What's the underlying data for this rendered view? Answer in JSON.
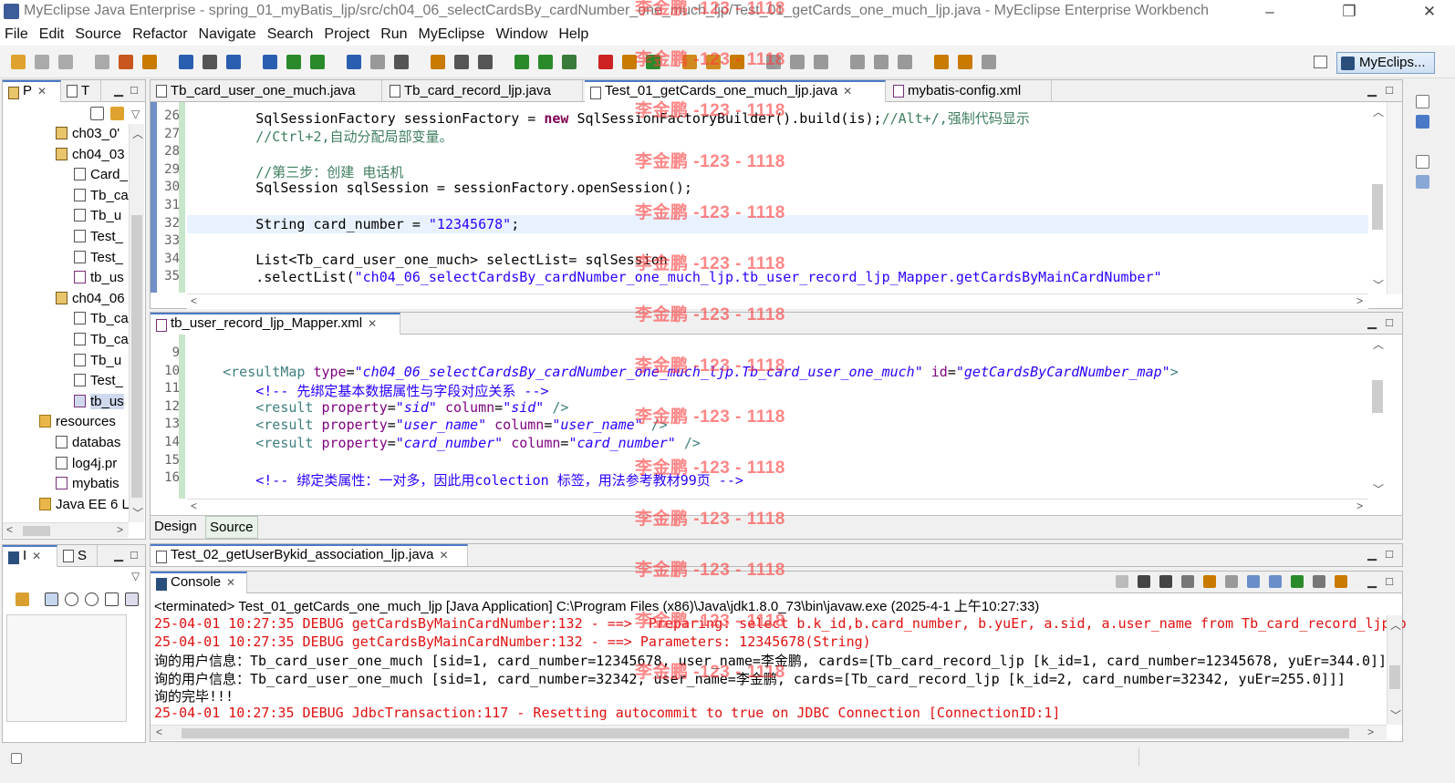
{
  "window": {
    "title": "MyEclipse Java Enterprise - spring_01_myBatis_ljp/src/ch04_06_selectCardsBy_cardNumber_one_much_ljp/Test_01_getCards_one_much_ljp.java - MyEclipse Enterprise Workbench",
    "minimize": "–",
    "restore": "❐",
    "close": "✕"
  },
  "menu": [
    "File",
    "Edit",
    "Source",
    "Refactor",
    "Navigate",
    "Search",
    "Project",
    "Run",
    "MyEclipse",
    "Window",
    "Help"
  ],
  "toolbar": {
    "perspective_label": "MyEclips..."
  },
  "explorer": {
    "tabs": [
      "P",
      "T"
    ],
    "items": [
      {
        "label": "ch03_0'",
        "icon": "package"
      },
      {
        "label": "ch04_03",
        "icon": "package"
      },
      {
        "label": "Card_",
        "icon": "java"
      },
      {
        "label": "Tb_ca",
        "icon": "java"
      },
      {
        "label": "Tb_u",
        "icon": "java"
      },
      {
        "label": "Test_",
        "icon": "java"
      },
      {
        "label": "Test_",
        "icon": "java"
      },
      {
        "label": "tb_us",
        "icon": "xml"
      },
      {
        "label": "ch04_06",
        "icon": "package"
      },
      {
        "label": "Tb_ca",
        "icon": "java"
      },
      {
        "label": "Tb_ca",
        "icon": "java"
      },
      {
        "label": "Tb_u",
        "icon": "java"
      },
      {
        "label": "Test_",
        "icon": "java"
      },
      {
        "label": "tb_us",
        "icon": "xml"
      },
      {
        "label": "resources",
        "icon": "folder"
      },
      {
        "label": "databas",
        "icon": "file"
      },
      {
        "label": "log4j.pr",
        "icon": "file"
      },
      {
        "label": "mybatis",
        "icon": "xml"
      },
      {
        "label": "Java EE 6 L",
        "icon": "lib"
      }
    ]
  },
  "outline": {
    "tabs": [
      "I",
      "S"
    ]
  },
  "editor1": {
    "tabs": [
      "Tb_card_user_one_much.java",
      "Tb_card_record_ljp.java",
      "Test_01_getCards_one_much_ljp.java",
      "mybatis-config.xml"
    ],
    "active_tab": 2,
    "lines": [
      {
        "n": "26",
        "segs": [
          {
            "t": "        SqlSessionFactory sessionFactory = "
          },
          {
            "t": "new",
            "c": "kw"
          },
          {
            "t": " SqlSessionFactoryBuilder().build(is);"
          },
          {
            "t": "//Alt+/,强制代码显示",
            "c": "cm"
          }
        ]
      },
      {
        "n": "27",
        "segs": [
          {
            "t": "        //Ctrl+2,自动分配局部变量。",
            "c": "cm"
          }
        ]
      },
      {
        "n": "28",
        "segs": [
          {
            "t": ""
          }
        ]
      },
      {
        "n": "29",
        "segs": [
          {
            "t": "        //第三步：创建 电话机",
            "c": "cm"
          }
        ]
      },
      {
        "n": "30",
        "segs": [
          {
            "t": "        SqlSession sqlSession = sessionFactory.openSession();"
          }
        ]
      },
      {
        "n": "31",
        "segs": [
          {
            "t": ""
          }
        ]
      },
      {
        "n": "32",
        "segs": [
          {
            "t": "        String card_number = "
          },
          {
            "t": "\"12345678\"",
            "c": "st"
          },
          {
            "t": ";"
          }
        ]
      },
      {
        "n": "33",
        "segs": [
          {
            "t": ""
          }
        ]
      },
      {
        "n": "34",
        "segs": [
          {
            "t": "        List<Tb_card_user_one_much> selectList= sqlSession"
          }
        ]
      },
      {
        "n": "35",
        "segs": [
          {
            "t": "        .selectList("
          },
          {
            "t": "\"ch04_06_selectCardsBy_cardNumber_one_much_ljp.tb_user_record_ljp_Mapper.getCardsByMainCardNumber\"",
            "c": "st"
          }
        ]
      }
    ]
  },
  "editor2": {
    "tab": "tb_user_record_ljp_Mapper.xml",
    "bottom_tabs": [
      "Design",
      "Source"
    ],
    "lines": [
      {
        "n": "9",
        "segs": [
          {
            "t": ""
          }
        ]
      },
      {
        "n": "10",
        "segs": [
          {
            "t": "    <",
            "c": "xt"
          },
          {
            "t": "resultMap",
            "c": "xt"
          },
          {
            "t": " type",
            "c": "xa"
          },
          {
            "t": "="
          },
          {
            "t": "\"ch04_06_selectCardsBy_cardNumber_one_much_ljp.Tb_card_user_one_much\"",
            "c": "xv"
          },
          {
            "t": " id",
            "c": "xa"
          },
          {
            "t": "="
          },
          {
            "t": "\"getCardsByCardNumber_map\"",
            "c": "xv"
          },
          {
            "t": ">",
            "c": "xt"
          }
        ]
      },
      {
        "n": "11",
        "segs": [
          {
            "t": "        <!-- 先绑定基本数据属性与字段对应关系 -->",
            "c": "st"
          }
        ]
      },
      {
        "n": "12",
        "segs": [
          {
            "t": "        <",
            "c": "xt"
          },
          {
            "t": "result",
            "c": "xt"
          },
          {
            "t": " property",
            "c": "xa"
          },
          {
            "t": "="
          },
          {
            "t": "\"sid\"",
            "c": "xv"
          },
          {
            "t": " column",
            "c": "xa"
          },
          {
            "t": "="
          },
          {
            "t": "\"sid\"",
            "c": "xv"
          },
          {
            "t": " />",
            "c": "xt"
          }
        ]
      },
      {
        "n": "13",
        "segs": [
          {
            "t": "        <",
            "c": "xt"
          },
          {
            "t": "result",
            "c": "xt"
          },
          {
            "t": " property",
            "c": "xa"
          },
          {
            "t": "="
          },
          {
            "t": "\"user_name\"",
            "c": "xv"
          },
          {
            "t": " column",
            "c": "xa"
          },
          {
            "t": "="
          },
          {
            "t": "\"user_name\"",
            "c": "xv"
          },
          {
            "t": " />",
            "c": "xt"
          }
        ]
      },
      {
        "n": "14",
        "segs": [
          {
            "t": "        <",
            "c": "xt"
          },
          {
            "t": "result",
            "c": "xt"
          },
          {
            "t": " property",
            "c": "xa"
          },
          {
            "t": "="
          },
          {
            "t": "\"card_number\"",
            "c": "xv"
          },
          {
            "t": " column",
            "c": "xa"
          },
          {
            "t": "="
          },
          {
            "t": "\"card_number\"",
            "c": "xv"
          },
          {
            "t": " />",
            "c": "xt"
          }
        ]
      },
      {
        "n": "15",
        "segs": [
          {
            "t": ""
          }
        ]
      },
      {
        "n": "16",
        "segs": [
          {
            "t": "        <!-- 绑定类属性：一对多，因此用colection 标签，用法参考教材99页 -->",
            "c": "st"
          }
        ]
      }
    ]
  },
  "editor3": {
    "tab": "Test_02_getUserBykid_association_ljp.java"
  },
  "console": {
    "tab": "Console",
    "header": "<terminated> Test_01_getCards_one_much_ljp [Java Application] C:\\Program Files (x86)\\Java\\jdk1.8.0_73\\bin\\javaw.exe (2025-4-1 上午10:27:33)",
    "lines": [
      {
        "t": "25-04-01 10:27:35 DEBUG getCardsByMainCardNumber:132 - ==>  Preparing: select b.k_id,b.card_number, b.yuEr, a.sid, a.user_name from Tb_card_record_ljp b",
        "red": true
      },
      {
        "t": "25-04-01 10:27:35 DEBUG getCardsByMainCardNumber:132 - ==> Parameters: 12345678(String)",
        "red": true
      },
      {
        "t": "询的用户信息：Tb_card_user_one_much [sid=1, card_number=12345678, user_name=李金鹏, cards=[Tb_card_record_ljp [k_id=1, card_number=12345678, yuEr=344.0]]",
        "red": false
      },
      {
        "t": "询的用户信息：Tb_card_user_one_much [sid=1, card_number=32342, user_name=李金鹏, cards=[Tb_card_record_ljp [k_id=2, card_number=32342, yuEr=255.0]]]",
        "red": false
      },
      {
        "t": "询的完毕!!!",
        "red": false
      },
      {
        "t": "25-04-01 10:27:35 DEBUG JdbcTransaction:117 - Resetting autocommit to true on JDBC Connection [ConnectionID:1]",
        "red": true
      }
    ]
  },
  "watermark": "李金鹏 -123 - 1118"
}
